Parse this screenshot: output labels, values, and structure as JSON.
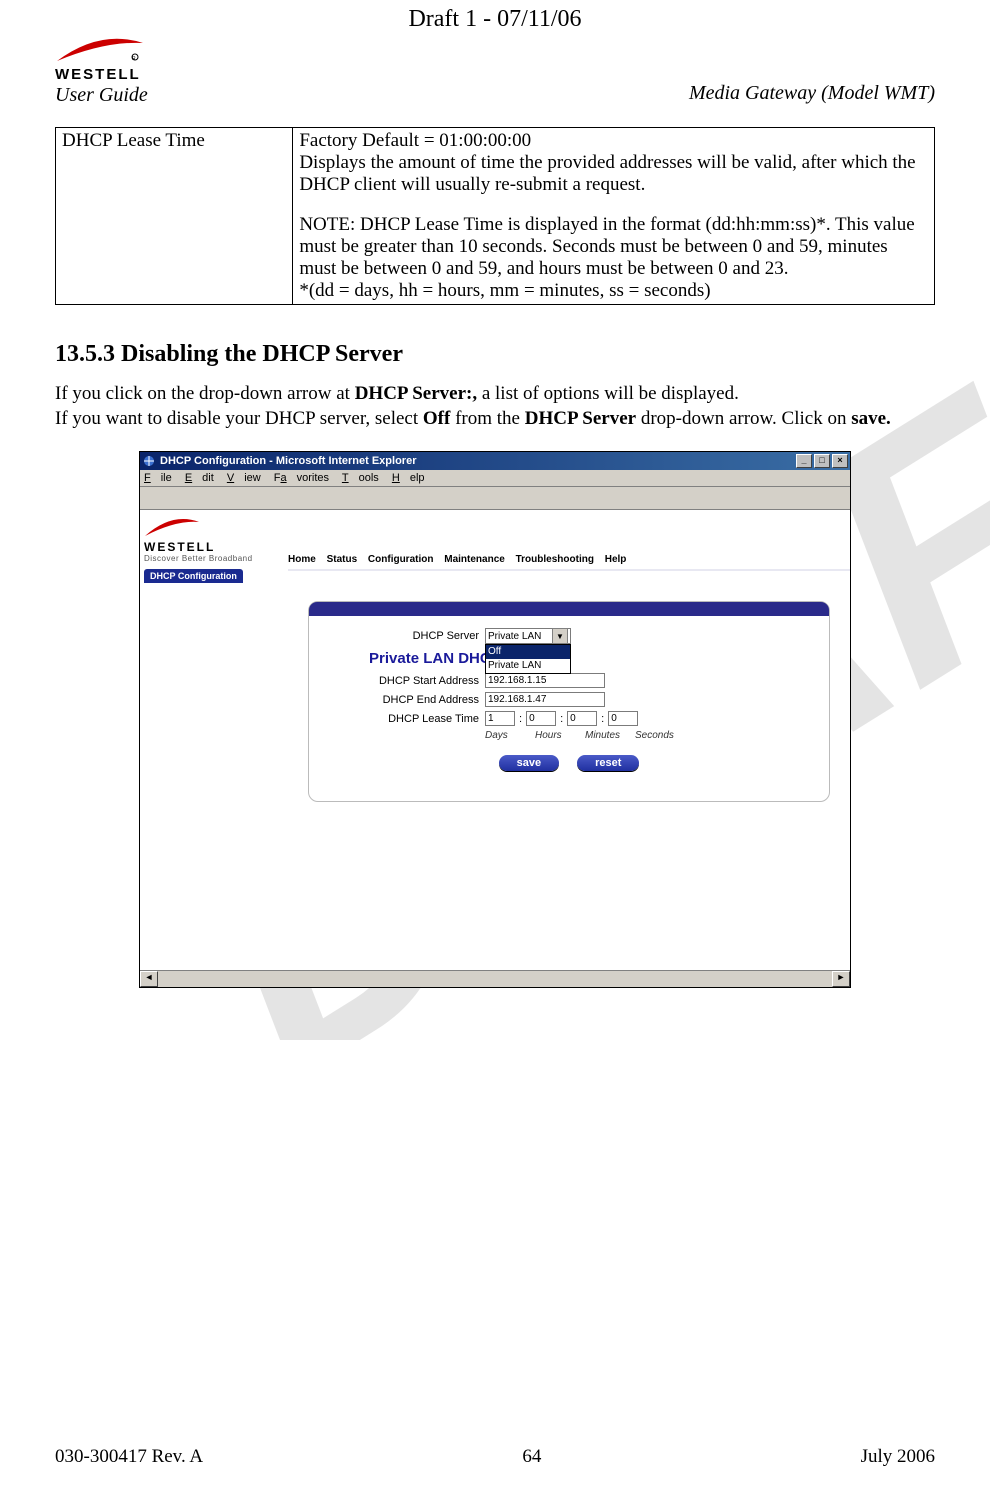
{
  "draft_header": "Draft 1 - 07/11/06",
  "logo_brand": "WESTELL",
  "user_guide": "User Guide",
  "header_right": "Media Gateway (Model WMT)",
  "table": {
    "left": "DHCP Lease Time",
    "r_line1": "Factory Default = 01:00:00:00",
    "r_line2": "Displays the amount of time the provided addresses will be valid, after which the DHCP client will usually re-submit a request.",
    "r_note": "NOTE: DHCP Lease Time is displayed in the format (dd:hh:mm:ss)*. This value must be greater than 10 seconds. Seconds must be between 0 and 59, minutes must be between 0 and 59, and hours must be between 0 and 23.",
    "r_foot": "*(dd = days, hh = hours, mm = minutes, ss = seconds)"
  },
  "section_heading": "13.5.3 Disabling the DHCP Server",
  "body": {
    "p1_a": "If you click on the drop-down arrow at ",
    "p1_b": "DHCP Server:,",
    "p1_c": " a list of options will be displayed.",
    "p2_a": "If you want to disable your DHCP server, select ",
    "p2_b": "Off",
    "p2_c": " from the ",
    "p2_d": "DHCP Server",
    "p2_e": " drop-down arrow. Click on ",
    "p2_f": "save."
  },
  "shot": {
    "title": "DHCP Configuration - Microsoft Internet Explorer",
    "menu": {
      "file": "File",
      "edit": "Edit",
      "view": "View",
      "fav": "Favorites",
      "tools": "Tools",
      "help": "Help"
    },
    "brand": "WESTELL",
    "tagline": "Discover Better Broadband",
    "nav": {
      "home": "Home",
      "status": "Status",
      "config": "Configuration",
      "maint": "Maintenance",
      "trouble": "Troubleshooting",
      "help": "Help"
    },
    "subnav": "DHCP Configuration",
    "form": {
      "server_label": "DHCP Server",
      "server_value": "Private LAN",
      "options": {
        "off": "Off",
        "plan": "Private LAN"
      },
      "heading": "Private LAN DHCP Settings",
      "start_label": "DHCP Start Address",
      "start_value": "192.168.1.15",
      "end_label": "DHCP End Address",
      "end_value": "192.168.1.47",
      "lease_label": "DHCP Lease Time",
      "days": "1",
      "hours": "0",
      "minutes": "0",
      "seconds": "0",
      "u_days": "Days",
      "u_hours": "Hours",
      "u_minutes": "Minutes",
      "u_seconds": "Seconds",
      "save": "save",
      "reset": "reset"
    }
  },
  "footer": {
    "left": "030-300417 Rev. A",
    "center": "64",
    "right": "July 2006"
  }
}
